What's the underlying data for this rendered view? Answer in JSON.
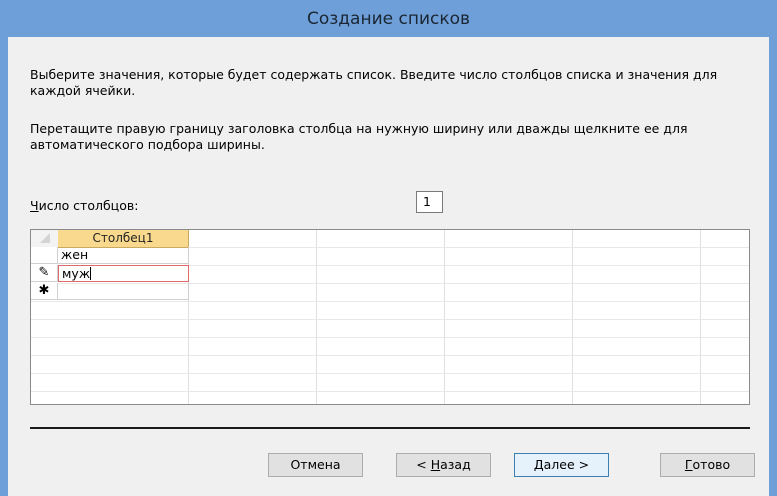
{
  "dialog": {
    "title": "Создание списков",
    "description1": "Выберите значения, которые будет содержать список. Введите число столбцов списка и значения для каждой ячейки.",
    "description2": "Перетащите правую границу заголовка столбца на нужную ширину или дважды щелкните ее для автоматического подбора ширины.",
    "ncols_label_first": "Ч",
    "ncols_label_rest": "исло столбцов:",
    "ncols_value": "1"
  },
  "grid": {
    "column_header": "Столбец1",
    "rows": [
      {
        "value": "жен",
        "selector": ""
      },
      {
        "value": "муж",
        "selector": "✎"
      },
      {
        "value": "",
        "selector": "✱"
      }
    ]
  },
  "buttons": {
    "cancel": "Отмена",
    "back_prefix": "< ",
    "back_key": "Н",
    "back_rest": "азад",
    "next_key": "Д",
    "next_rest": "алее >",
    "finish_key": "Г",
    "finish_rest": "отово"
  }
}
